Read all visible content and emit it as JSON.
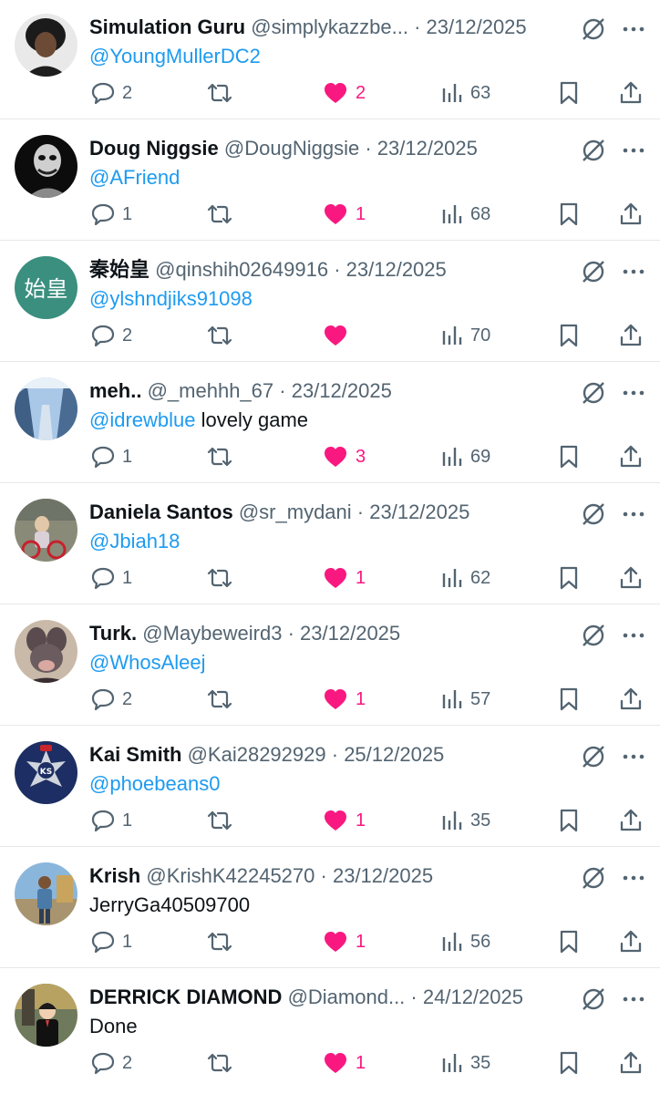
{
  "colors": {
    "like": "#f91880",
    "mention": "#1d9bf0",
    "muted": "#536471",
    "text": "#0f1419",
    "divider": "#e5e8eb"
  },
  "icons": {
    "reply": "reply-icon",
    "retweet": "retweet-icon",
    "like": "heart-icon",
    "views": "views-icon",
    "bookmark": "bookmark-icon",
    "share": "share-icon",
    "grok": "grok-icon",
    "more": "more-icon"
  },
  "tweets": [
    {
      "name": "Simulation Guru",
      "handle": "@simplykazzbe...",
      "sep": "·",
      "date": "23/12/2025",
      "mention": "@YoungMullerDC2",
      "text": "",
      "replies": "2",
      "likes": "2",
      "views": "63"
    },
    {
      "name": "Doug Niggsie",
      "handle": "@DougNiggsie",
      "sep": "·",
      "date": "23/12/2025",
      "mention": "@AFriend",
      "text": "",
      "replies": "1",
      "likes": "1",
      "views": "68"
    },
    {
      "name": "秦始皇",
      "handle": "@qinshih02649916",
      "sep": "·",
      "date": "23/12/2025",
      "mention": "@ylshndjiks91098",
      "text": "",
      "replies": "2",
      "likes": "",
      "views": "70",
      "avatar_text": "始皇"
    },
    {
      "name": "meh..",
      "handle": "@_mehhh_67",
      "sep": "·",
      "date": "23/12/2025",
      "mention": "@idrewblue",
      "text": " lovely game",
      "replies": "1",
      "likes": "3",
      "views": "69"
    },
    {
      "name": "Daniela Santos",
      "handle": "@sr_mydani",
      "sep": "·",
      "date": "23/12/2025",
      "mention": "@Jbiah18",
      "text": "",
      "replies": "1",
      "likes": "1",
      "views": "62"
    },
    {
      "name": "Turk.",
      "handle": "@Maybeweird3",
      "sep": "·",
      "date": "23/12/2025",
      "mention": "@WhosAleej",
      "text": "",
      "replies": "2",
      "likes": "1",
      "views": "57"
    },
    {
      "name": "Kai Smith",
      "handle": "@Kai28292929",
      "sep": "·",
      "date": "25/12/2025",
      "mention": "@phoebeans0",
      "text": "",
      "replies": "1",
      "likes": "1",
      "views": "35",
      "avatar_text": "KS"
    },
    {
      "name": "Krish",
      "handle": "@KrishK42245270",
      "sep": "·",
      "date": "23/12/2025",
      "mention": "",
      "text": "JerryGa40509700",
      "replies": "1",
      "likes": "1",
      "views": "56"
    },
    {
      "name": "DERRICK DIAMOND",
      "handle": "@Diamond...",
      "sep": "·",
      "date": "24/12/2025",
      "mention": "",
      "text": "Done",
      "replies": "2",
      "likes": "1",
      "views": "35"
    }
  ]
}
